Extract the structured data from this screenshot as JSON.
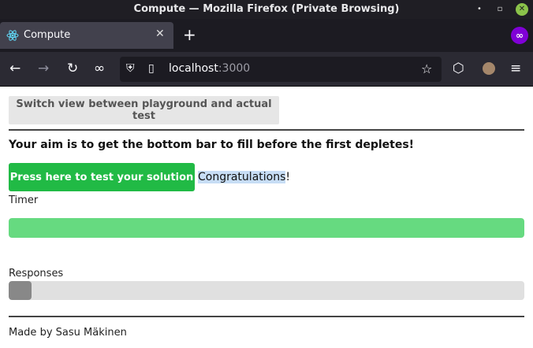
{
  "window": {
    "title": "Compute — Mozilla Firefox (Private Browsing)",
    "minimize_glyph": "•",
    "maximize_glyph": "▫",
    "close_glyph": "✕"
  },
  "tabs": [
    {
      "label": "Compute",
      "icon": "react-atom-icon",
      "close_glyph": "✕"
    }
  ],
  "new_tab_glyph": "+",
  "private_browsing_glyph": "∞",
  "navbar": {
    "back_glyph": "←",
    "forward_glyph": "→",
    "reload_glyph": "↻",
    "tracking_glyph": "∞",
    "shield_glyph": "⛨",
    "page_glyph": "▯",
    "url_host": "localhost",
    "url_port": ":3000",
    "bookmark_glyph": "☆",
    "pocket_glyph": "⬡",
    "menu_glyph": "≡"
  },
  "page": {
    "switch_button_label": "Switch view between playground and actual test",
    "aim_text": "Your aim is to get the bottom bar to fill before the first depletes!",
    "test_button_label": "Press here to test your solution",
    "congrats_selected": "Congratulations",
    "congrats_rest": "!",
    "timer_label": "Timer",
    "timer_fill_percent": 100,
    "responses_label": "Responses",
    "responses_fill_percent": 4.4,
    "footer": "Made by Sasu Mäkinen"
  },
  "colors": {
    "test_button": "#21ba45",
    "timer_fill": "#66da80",
    "responses_fill": "#888888",
    "bar_track": "#e0e0e0",
    "selection_highlight": "#c7ddf5"
  }
}
